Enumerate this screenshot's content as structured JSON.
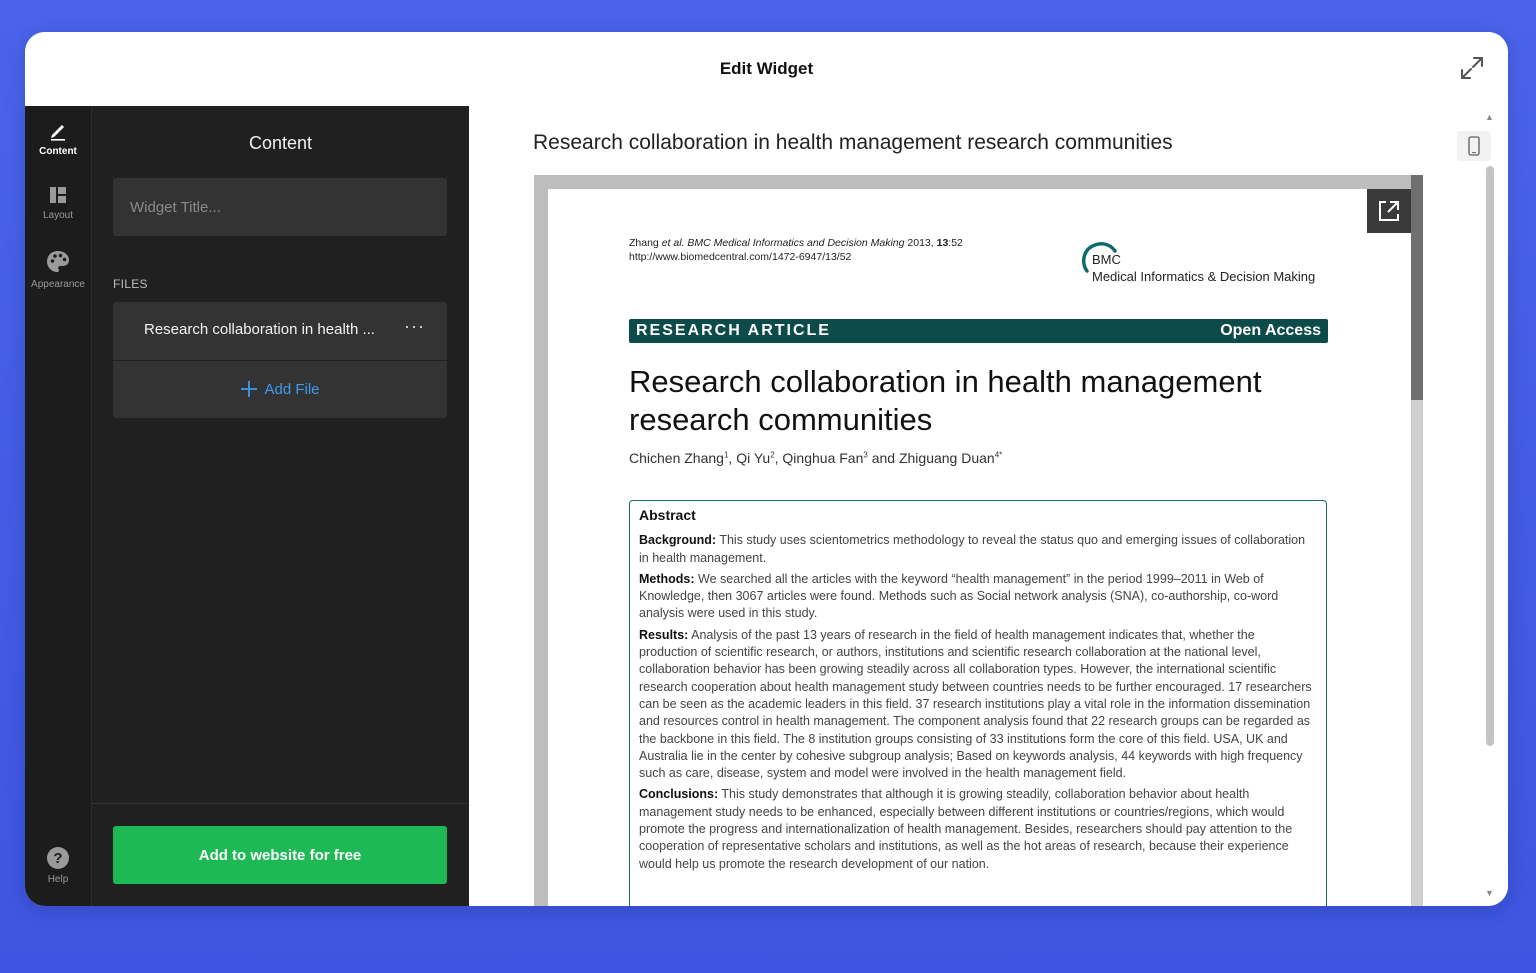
{
  "window": {
    "title": "Edit Widget"
  },
  "rail": {
    "items": [
      {
        "label": "Content",
        "icon": "pencil-icon",
        "active": true
      },
      {
        "label": "Layout",
        "icon": "layout-icon",
        "active": false
      },
      {
        "label": "Appearance",
        "icon": "palette-icon",
        "active": false
      }
    ],
    "help_label": "Help"
  },
  "panel": {
    "title": "Content",
    "title_input": {
      "placeholder": "Widget Title...",
      "value": ""
    },
    "files_label": "FILES",
    "files": [
      {
        "name": "Research collaboration in health ..."
      }
    ],
    "add_file_label": "Add File",
    "cta_label": "Add to website for free"
  },
  "preview": {
    "title": "Research collaboration in health management research communities",
    "pdf": {
      "citation_authors": "Zhang",
      "citation_etal": "et al.",
      "citation_journal": "BMC Medical Informatics and Decision Making",
      "citation_year": "2013,",
      "citation_volume": "13",
      "citation_issue": ":52",
      "citation_url": "http://www.biomedcentral.com/1472-6947/13/52",
      "publisher": "BMC",
      "journal": "Medical Informatics & Decision Making",
      "article_type": "RESEARCH ARTICLE",
      "access": "Open Access",
      "title": "Research collaboration in health management research communities",
      "authors": [
        {
          "name": "Chichen Zhang",
          "sup": "1"
        },
        {
          "name": "Qi Yu",
          "sup": "2"
        },
        {
          "name": "Qinghua Fan",
          "sup": "3"
        },
        {
          "name": "Zhiguang Duan",
          "sup": "4*"
        }
      ],
      "author_sep": ", ",
      "author_and": " and ",
      "abstract_heading": "Abstract",
      "abstract": [
        {
          "label": "Background:",
          "text": "This study uses scientometrics methodology to reveal the status quo and emerging issues of collaboration in health management."
        },
        {
          "label": "Methods:",
          "text": "We searched all the articles with the keyword “health management” in the period 1999–2011 in Web of Knowledge, then 3067 articles were found. Methods such as Social network analysis (SNA), co-authorship, co-word analysis were used in this study."
        },
        {
          "label": "Results:",
          "text": "Analysis of the past 13 years of research in the field of health management indicates that, whether the production of scientific research, or authors, institutions and scientific research collaboration at the national level, collaboration behavior has been growing steadily across all collaboration types. However, the international scientific research cooperation about health management study between countries needs to be further encouraged. 17 researchers can be seen as the academic leaders in this field. 37 research institutions play a vital role in the information dissemination and resources control in health management. The component analysis found that 22 research groups can be regarded as the backbone in this field. The 8 institution groups consisting of 33 institutions form the core of this field. USA, UK and Australia lie in the center by cohesive subgroup analysis; Based on keywords analysis, 44 keywords with high frequency such as care, disease, system and model were involved in the health management field."
        },
        {
          "label": "Conclusions:",
          "text": "This study demonstrates that although it is growing steadily, collaboration behavior about health management study needs to be enhanced, especially between different institutions or countries/regions, which would promote the progress and internationalization of health management. Besides, researchers should pay attention to the cooperation of representative scholars and institutions, as well as the hot areas of research, because their experience would help us promote the research development of our nation."
        }
      ]
    }
  },
  "colors": {
    "background": "#4a63ea",
    "cta": "#1db954",
    "link": "#3c9cf0",
    "article_bar": "#0d4a4a"
  }
}
